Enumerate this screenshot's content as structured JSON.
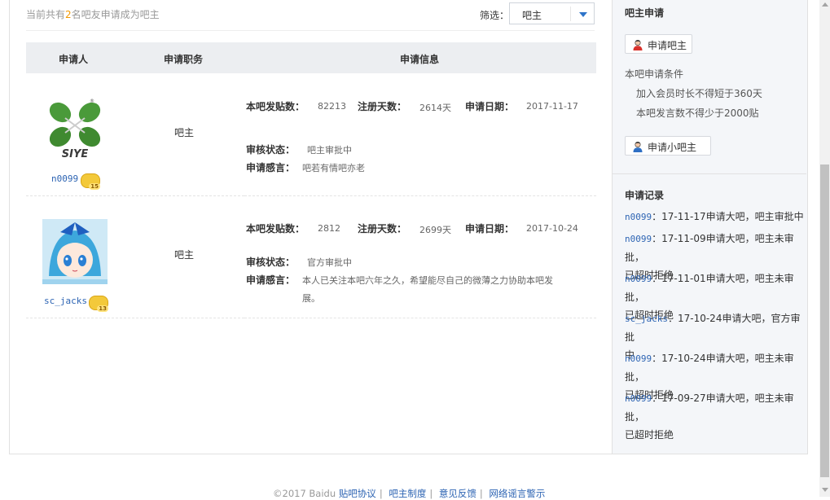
{
  "summary": {
    "prefix": "当前共有",
    "count": "2",
    "suffix": "名吧友申请成为吧主"
  },
  "filter": {
    "label": "筛选：",
    "value": "吧主"
  },
  "table": {
    "headers": [
      "申请人",
      "申请职务",
      "申请信息"
    ],
    "rows": [
      {
        "user": "n0099",
        "level": "15",
        "role": "吧主",
        "labels": {
          "posts": "本吧发贴数：",
          "days": "注册天数：",
          "date": "申请日期：",
          "status": "审核状态：",
          "words": "申请感言："
        },
        "posts": "82213",
        "days": "2614天",
        "date": "2017-11-17",
        "status": "吧主审批中",
        "words": [
          "吧若有情吧亦老"
        ]
      },
      {
        "user": "sc_jacks",
        "level": "13",
        "role": "吧主",
        "labels": {
          "posts": "本吧发贴数：",
          "days": "注册天数：",
          "date": "申请日期：",
          "status": "审核状态：",
          "words": "申请感言："
        },
        "posts": "2812",
        "days": "2699天",
        "date": "2017-10-24",
        "status": "官方审批中",
        "words": [
          "本人已关注本吧六年之久，希望能尽自己的微薄之力协助本吧发",
          "展。"
        ]
      }
    ]
  },
  "sidebar": {
    "apply_title": "吧主申请",
    "apply_button": "申请吧主",
    "conditions_title": "本吧申请条件",
    "conditions": [
      "加入会员时长不得短于360天",
      "本吧发言数不得少于2000贴"
    ],
    "apply_small_button": "申请小吧主",
    "records_title": "申请记录",
    "records": [
      {
        "user": "n0099",
        "lines": [
          "：17-11-17申请大吧，吧主审批中"
        ]
      },
      {
        "user": "n0099",
        "lines": [
          "：17-11-09申请大吧，吧主未审批，",
          "已超时拒绝"
        ]
      },
      {
        "user": "n0099",
        "lines": [
          "：17-11-01申请大吧，吧主未审批，",
          "已超时拒绝"
        ]
      },
      {
        "user": "sc_jacks",
        "lines": [
          "：17-10-24申请大吧，官方审批",
          "中"
        ]
      },
      {
        "user": "n0099",
        "lines": [
          "：17-10-24申请大吧，吧主未审批，",
          "已超时拒绝"
        ]
      },
      {
        "user": "n0099",
        "lines": [
          "：17-09-27申请大吧，吧主未审批，",
          "已超时拒绝"
        ]
      }
    ]
  },
  "footer": {
    "copyright": "©2017 Baidu",
    "links": [
      "贴吧协议",
      "吧主制度",
      "意见反馈",
      "网络谣言警示"
    ]
  },
  "colors": {
    "accent": "#2d64b3",
    "count": "#f39800",
    "header_bg": "#eceef1",
    "sidebar_bg": "#f4f6f9"
  },
  "icons": {
    "filter_dropdown": "chevron-down-icon",
    "person": "person-icon",
    "level_badge": "level-badge-icon"
  }
}
